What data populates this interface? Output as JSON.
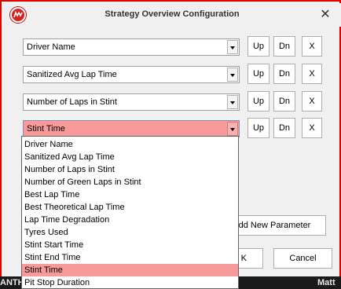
{
  "window": {
    "title": "Strategy Overview Configuration",
    "close_glyph": "✕",
    "app_icon": "strategy-logo-icon",
    "border_color": "#e00000"
  },
  "rows": [
    {
      "selected": "Driver Name",
      "up": "Up",
      "down": "Dn",
      "remove": "X"
    },
    {
      "selected": "Sanitized Avg Lap Time",
      "up": "Up",
      "down": "Dn",
      "remove": "X"
    },
    {
      "selected": "Number of Laps in Stint",
      "up": "Up",
      "down": "Dn",
      "remove": "X"
    },
    {
      "selected": "Stint Time",
      "up": "Up",
      "down": "Dn",
      "remove": "X"
    }
  ],
  "dropdown": {
    "options": [
      "Driver Name",
      "Sanitized Avg Lap Time",
      "Number of Laps in Stint",
      "Number of Green Laps in Stint",
      "Best Lap Time",
      "Best Theoretical Lap Time",
      "Lap Time Degradation",
      "Tyres Used",
      "Stint Start Time",
      "Stint End Time",
      "Stint Time",
      "Pit Stop Duration"
    ],
    "selected_index": 10,
    "highlight_color": "#f89a9a"
  },
  "buttons": {
    "add_parameter": "dd New Parameter",
    "ok": "K",
    "cancel": "Cancel"
  },
  "background": {
    "left_text": "ANTH",
    "right_text": "Matt"
  }
}
